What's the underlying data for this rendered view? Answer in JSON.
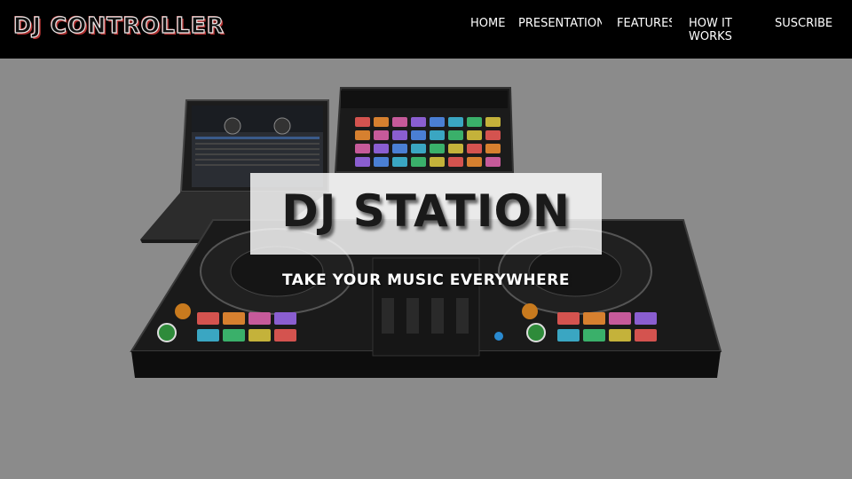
{
  "header": {
    "logo_text": "DJ CONTROLLER",
    "nav": [
      {
        "label": "HOME"
      },
      {
        "label": "PRESENTATION"
      },
      {
        "label": "FEATURES"
      },
      {
        "label": "HOW IT WORKS"
      },
      {
        "label": "SUSCRIBE"
      }
    ]
  },
  "hero": {
    "title": "DJ STATION",
    "tagline": "TAKE YOUR MUSIC EVERYWHERE"
  },
  "colors": {
    "header_bg": "#000000",
    "hero_bg": "#8b8b8b",
    "logo_accent": "#b03030",
    "title_box": "#ffffff"
  }
}
